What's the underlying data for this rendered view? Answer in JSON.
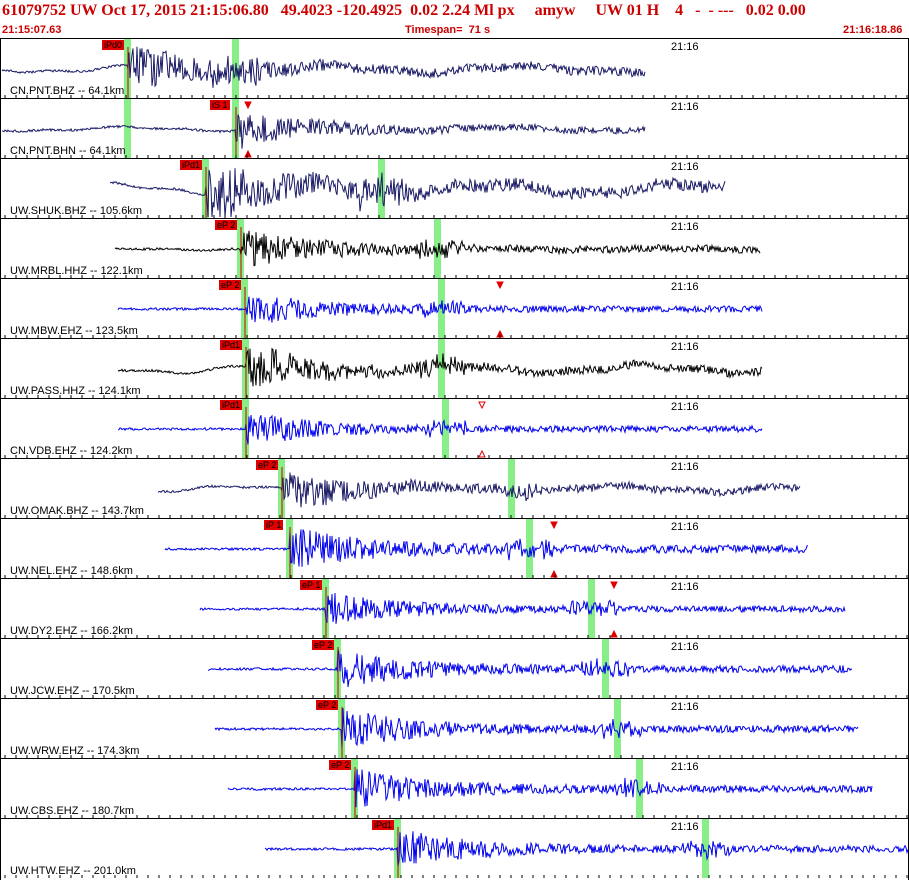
{
  "header": {
    "title": "61079752 UW Oct 17, 2015 21:15:06.80   49.4023 -120.4925  0.02 2.24 Ml px     amyw     UW 01 H    4   -  - ---   0.02 0.00",
    "start_time": "21:15:07.63",
    "timespan": "Timespan=  71 s",
    "end_time": "21:16:18.86"
  },
  "time_mark": "21:16",
  "colors": {
    "header_text": "#cc0000",
    "pick_box": "#e00000",
    "trace_navy": "#1a1a66",
    "trace_black": "#000000",
    "trace_blue": "#0000ee",
    "green_marker": "#88ee88",
    "red_pick_line": "#cc0000"
  },
  "traces": [
    {
      "label": "CN.PNT.BHZ -- 64.1km",
      "pick": "iPd0",
      "color": "navy"
    },
    {
      "label": "CN.PNT.BHN -- 64.1km",
      "pick": "iS 1",
      "color": "navy"
    },
    {
      "label": "UW.SHUK.BHZ -- 105.6km",
      "pick": "iPd1",
      "color": "navy"
    },
    {
      "label": "UW.MRBL.HHZ -- 122.1km",
      "pick": "eP 2",
      "color": "black"
    },
    {
      "label": "UW.MBW.EHZ -- 123.5km",
      "pick": "eP 2",
      "color": "blue"
    },
    {
      "label": "UW.PASS.HHZ -- 124.1km",
      "pick": "iPd1",
      "color": "black"
    },
    {
      "label": "CN.VDB.EHZ -- 124.2km",
      "pick": "iPd1",
      "color": "blue"
    },
    {
      "label": "UW.OMAK.BHZ -- 143.7km",
      "pick": "eP 2",
      "color": "navy"
    },
    {
      "label": "UW.NEL.EHZ -- 148.6km",
      "pick": "iP 1",
      "color": "blue"
    },
    {
      "label": "UW.DY2.EHZ -- 166.2km",
      "pick": "eP 1",
      "color": "blue"
    },
    {
      "label": "UW.JCW.EHZ -- 170.5km",
      "pick": "eP 2",
      "color": "blue"
    },
    {
      "label": "UW.WRW.EHZ -- 174.3km",
      "pick": "eP 2",
      "color": "blue"
    },
    {
      "label": "UW.CBS.EHZ -- 180.7km",
      "pick": "eP 2",
      "color": "blue"
    },
    {
      "label": "UW.HTW.EHZ -- 201.0km",
      "pick": "iPd1",
      "color": "blue"
    }
  ]
}
